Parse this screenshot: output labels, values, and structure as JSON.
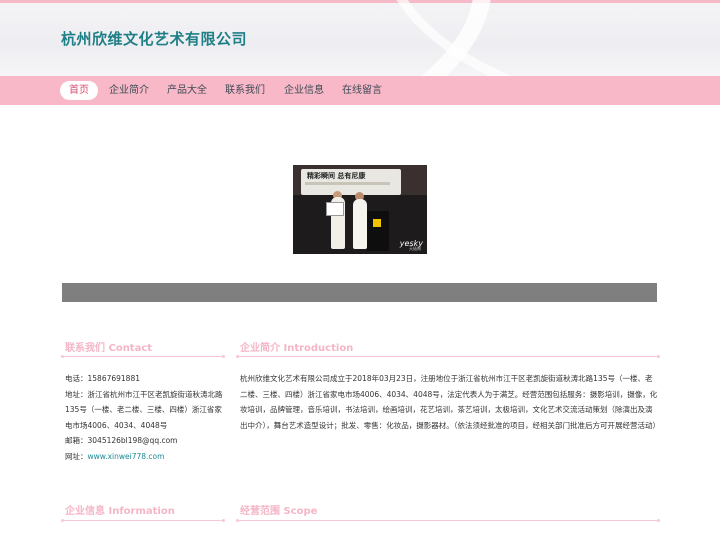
{
  "site": {
    "title": "杭州欣维文化艺术有限公司"
  },
  "nav": [
    {
      "label": "首页",
      "active": true
    },
    {
      "label": "企业简介"
    },
    {
      "label": "产品大全"
    },
    {
      "label": "联系我们"
    },
    {
      "label": "企业信息"
    },
    {
      "label": "在线留言"
    }
  ],
  "banner": {
    "sign_text": "精彩瞬间 总有尼康",
    "watermark": "yesky",
    "watermark_sub": "天极网"
  },
  "contact": {
    "title": "联系我们 Contact",
    "phone": "电话：15867691881",
    "address": "地址：浙江省杭州市江干区老凯旋街道秋涛北路135号（一楼、老二楼、三楼、四楼）浙江省家电市场4006、4034、4048号",
    "email": "邮箱：3045126bl198@qq.com",
    "website_label": "网址：",
    "website": "www.xinwei778.com"
  },
  "intro": {
    "title": "企业简介 Introduction",
    "body": "杭州欣维文化艺术有限公司成立于2018年03月23日，注册地位于浙江省杭州市江干区老凯旋街道秋涛北路135号（一楼、老二楼、三楼、四楼）浙江省家电市场4006、4034、4048号，法定代表人为于满芝。经营范围包括服务：摄影培训，摄像，化妆培训，品牌管理，音乐培训，书法培训，绘画培训，花艺培训，茶艺培训，太极培训，文化艺术交流活动策划（除演出及演出中介），舞台艺术造型设计；批发、零售：化妆品，摄影器材。（依法须经批准的项目，经相关部门批准后方可开展经营活动）"
  },
  "info": {
    "title": "企业信息 Information"
  },
  "scope": {
    "title": "经营范围 Scope"
  },
  "colors": {
    "nav_bg": "#f8b8c8",
    "title": "#1f7f86",
    "section_title": "#f4b6c6",
    "link": "#1f8a96"
  }
}
